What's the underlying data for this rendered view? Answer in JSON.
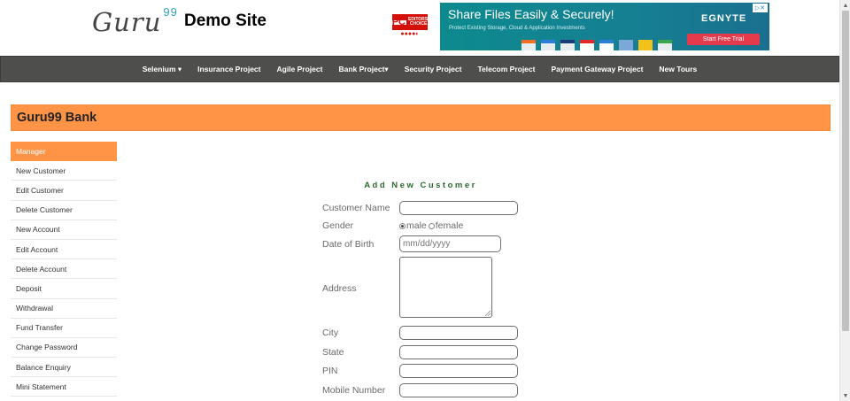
{
  "header": {
    "logo_text": "Guru",
    "logo_sup": "99",
    "site_title": "Demo Site"
  },
  "award_badge": {
    "pc": "PC",
    "caption": "EDITORS' CHOICE",
    "rating": "●●●●◐"
  },
  "ad": {
    "headline": "Share Files Easily & Securely!",
    "subline": "Protect Existing Storage, Cloud & Application Investments",
    "brand": "EGNYTE",
    "cta": "Start Free Trial",
    "adchoice": "▷✕",
    "brand_color": "#0d8a8e",
    "cta_color": "#e53a4c"
  },
  "nav": {
    "items": [
      "Selenium ▾",
      "Insurance Project",
      "Agile Project",
      "Bank Project▾",
      "Security Project",
      "Telecom Project",
      "Payment Gateway Project",
      "New Tours"
    ]
  },
  "bank": {
    "title": "Guru99 Bank",
    "accent_color": "#ff9446"
  },
  "sidebar": {
    "items": [
      "Manager",
      "New Customer",
      "Edit Customer",
      "Delete Customer",
      "New Account",
      "Edit Account",
      "Delete Account",
      "Deposit",
      "Withdrawal",
      "Fund Transfer",
      "Change Password",
      "Balance Enquiry",
      "Mini Statement"
    ],
    "active_index": 0
  },
  "form": {
    "title": "Add New Customer",
    "labels": {
      "customer_name": "Customer Name",
      "gender": "Gender",
      "dob": "Date of Birth",
      "address": "Address",
      "city": "City",
      "state": "State",
      "pin": "PIN",
      "mobile": "Mobile Number"
    },
    "gender_options": [
      "male",
      "female"
    ],
    "gender_selected": "male",
    "dob_placeholder": "mm/dd/yyyy"
  },
  "scrollbar": {
    "up": "▲",
    "down": "▼"
  }
}
